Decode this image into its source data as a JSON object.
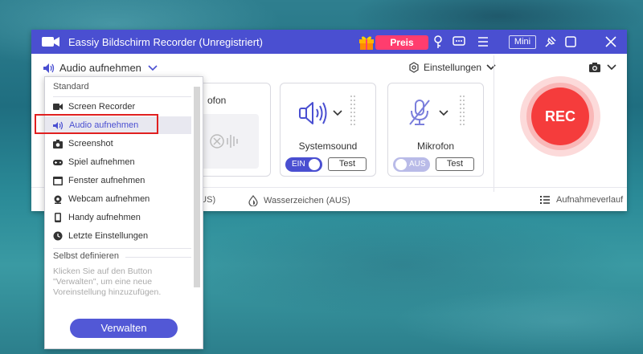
{
  "window": {
    "title": "Eassiy Bildschirm Recorder (Unregistriert)",
    "preis_label": "Preis",
    "mini_label": "Mini"
  },
  "toolbar": {
    "mode_label": "Audio aufnehmen",
    "settings_label": "Einstellungen"
  },
  "cards": {
    "partial_label": "ofon",
    "system": {
      "label": "Systemsound",
      "toggle": "EIN",
      "test": "Test"
    },
    "mic": {
      "label": "Mikrofon",
      "toggle": "AUS",
      "test": "Test"
    }
  },
  "rec_label": "REC",
  "statusbar": {
    "partial_item": "n (AUS)",
    "watermark": "Wasserzeichen (AUS)",
    "history": "Aufnahmeverlauf"
  },
  "dropdown": {
    "standard_heading": "Standard",
    "items": [
      {
        "label": "Screen Recorder",
        "icon": "video-camera-icon"
      },
      {
        "label": "Audio aufnehmen",
        "icon": "speaker-icon"
      },
      {
        "label": "Screenshot",
        "icon": "camera-icon"
      },
      {
        "label": "Spiel aufnehmen",
        "icon": "gamepad-icon"
      },
      {
        "label": "Fenster aufnehmen",
        "icon": "window-icon"
      },
      {
        "label": "Webcam aufnehmen",
        "icon": "webcam-icon"
      },
      {
        "label": "Handy aufnehmen",
        "icon": "phone-icon"
      },
      {
        "label": "Letzte Einstellungen",
        "icon": "clock-icon"
      }
    ],
    "custom_heading": "Selbst definieren",
    "custom_description": "Klicken Sie auf den Button \"Verwalten\", um eine neue Voreinstellung hinzuzufügen.",
    "manage_button": "Verwalten"
  },
  "colors": {
    "accent": "#4a4fd1",
    "rec": "#f53c3c",
    "preis": "#ff3d6e"
  }
}
